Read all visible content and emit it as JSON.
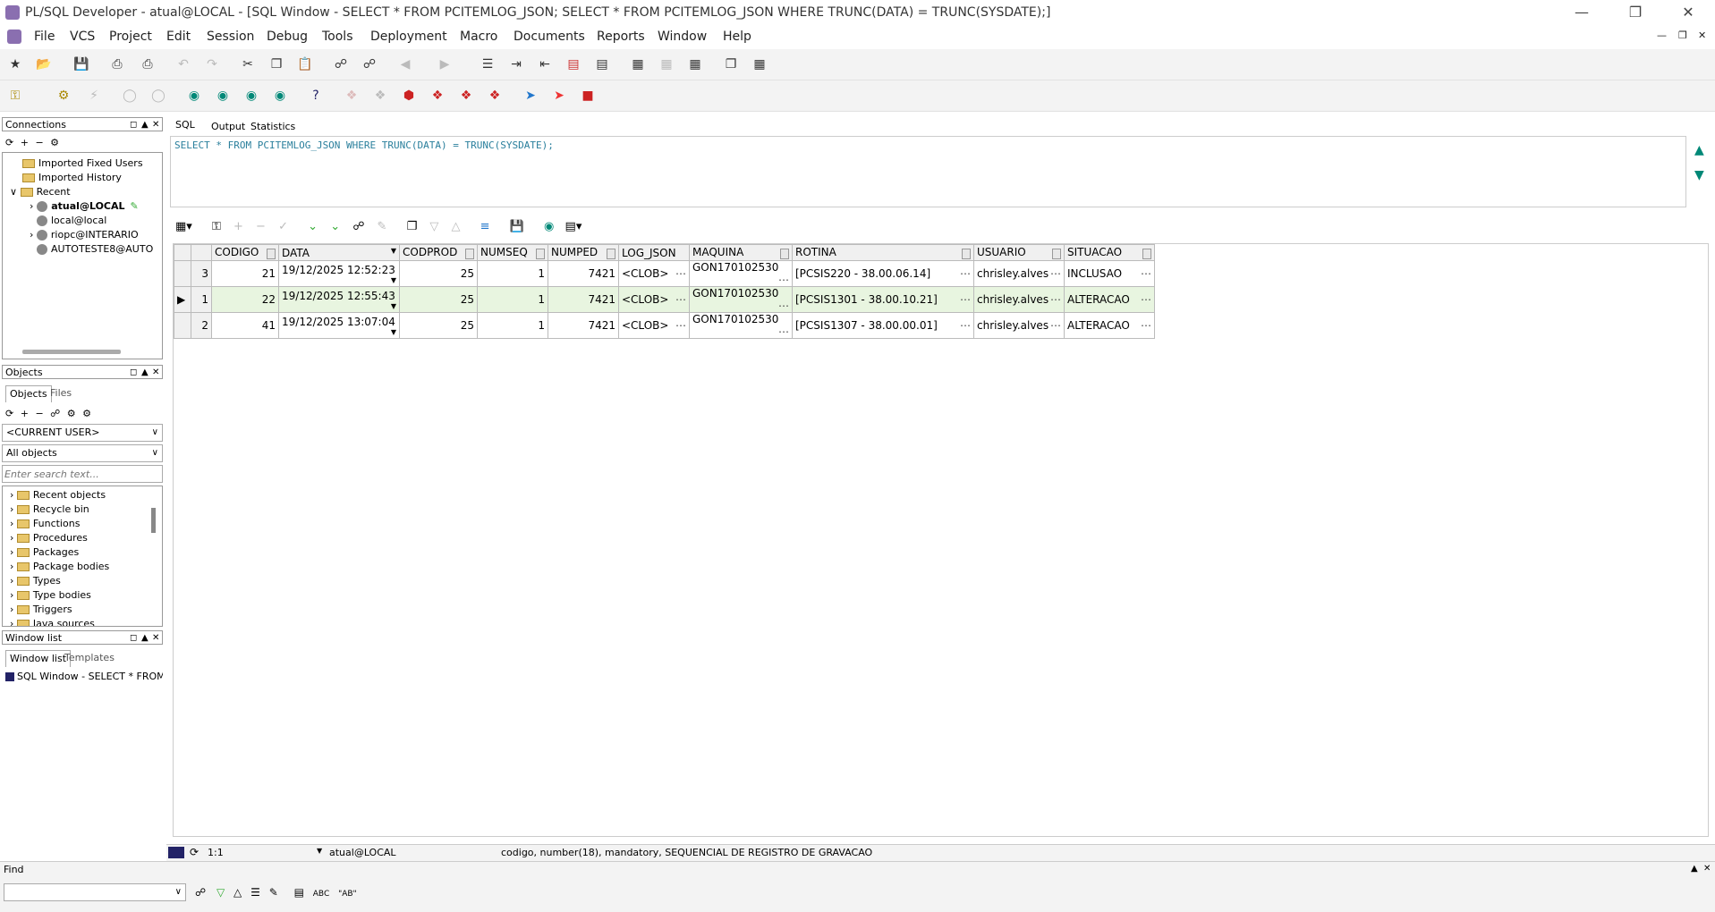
{
  "window": {
    "title": "PL/SQL Developer - atual@LOCAL - [SQL Window - SELECT * FROM PCITEMLOG_JSON; SELECT * FROM PCITEMLOG_JSON WHERE TRUNC(DATA) = TRUNC(SYSDATE);]"
  },
  "menu": [
    "File",
    "VCS",
    "Project",
    "Edit",
    "Session",
    "Debug",
    "Tools",
    "Deployment",
    "Macro",
    "Documents",
    "Reports",
    "Window",
    "Help"
  ],
  "connections": {
    "title": "Connections",
    "items": [
      "Imported Fixed Users",
      "Imported History",
      "Recent",
      "atual@LOCAL",
      "local@local",
      "riopc@INTERARIO",
      "AUTOTESTE8@AUTO"
    ]
  },
  "objects": {
    "title": "Objects",
    "tabs": [
      "Objects",
      "Files"
    ],
    "user_select": "<CURRENT USER>",
    "filter_select": "All objects",
    "search_placeholder": "Enter search text...",
    "items": [
      "Recent objects",
      "Recycle bin",
      "Functions",
      "Procedures",
      "Packages",
      "Package bodies",
      "Types",
      "Type bodies",
      "Triggers",
      "Java sources"
    ]
  },
  "windowlist": {
    "title": "Window list",
    "tabs": [
      "Window list",
      "Templates"
    ],
    "items": [
      "SQL Window - SELECT * FROM P"
    ]
  },
  "editor": {
    "tabs": [
      "SQL",
      "Output",
      "Statistics"
    ],
    "sql": "SELECT * FROM PCITEMLOG_JSON WHERE TRUNC(DATA) = TRUNC(SYSDATE);"
  },
  "grid": {
    "columns": [
      "CODIGO",
      "DATA",
      "CODPROD",
      "NUMSEQ",
      "NUMPED",
      "LOG_JSON",
      "MAQUINA",
      "ROTINA",
      "USUARIO",
      "SITUACAO"
    ],
    "rows": [
      {
        "rownum": "3",
        "codigo": "21",
        "data": "19/12/2025 12:52:23",
        "codprod": "25",
        "numseq": "1",
        "numped": "7421",
        "log_json": "<CLOB>",
        "maquina": "GON170102530",
        "rotina": "[PCSIS220 - 38.00.06.14]",
        "usuario": "chrisley.alves",
        "situacao": "INCLUSAO"
      },
      {
        "rownum": "1",
        "codigo": "22",
        "data": "19/12/2025 12:55:43",
        "codprod": "25",
        "numseq": "1",
        "numped": "7421",
        "log_json": "<CLOB>",
        "maquina": "GON170102530",
        "rotina": "[PCSIS1301 - 38.00.10.21]",
        "usuario": "chrisley.alves",
        "situacao": "ALTERACAO"
      },
      {
        "rownum": "2",
        "codigo": "41",
        "data": "19/12/2025 13:07:04",
        "codprod": "25",
        "numseq": "1",
        "numped": "7421",
        "log_json": "<CLOB>",
        "maquina": "GON170102530",
        "rotina": "[PCSIS1307 - 38.00.00.01]",
        "usuario": "chrisley.alves",
        "situacao": "ALTERACAO"
      }
    ]
  },
  "status": {
    "position": "1:1",
    "connection": "atual@LOCAL",
    "info": "codigo, number(18), mandatory, SEQUENCIAL DE REGISTRO DE GRAVACAO"
  },
  "find": {
    "label": "Find"
  }
}
